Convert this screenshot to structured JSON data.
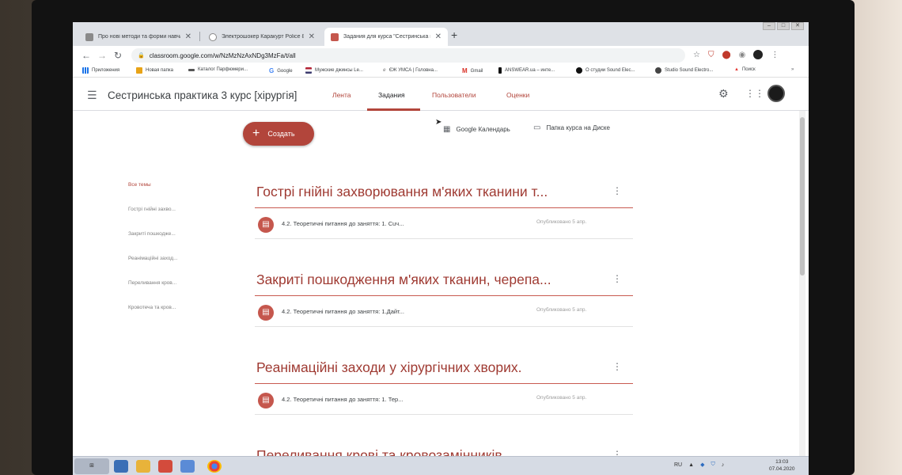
{
  "browser": {
    "tabs": [
      {
        "title": "Про нові методи та форми навчан"
      },
      {
        "title": "Электрошокер Каракурт Police 8L"
      },
      {
        "title": "Задания для курса \"Сестринська п"
      }
    ],
    "new_tab_label": "+",
    "url": "classroom.google.com/w/NzMzNzAxNDg3MzFa/t/all",
    "bookmarks": [
      {
        "label": "Приложения"
      },
      {
        "label": "Новая папка"
      },
      {
        "label": "Каталог Парфюмери..."
      },
      {
        "label": "Google"
      },
      {
        "label": "Мужские джинсы Le..."
      },
      {
        "label": "ЄЖ УМСА | Головна..."
      },
      {
        "label": "Gmail"
      },
      {
        "label": "ANSWEAR.ua – инте..."
      },
      {
        "label": "О студии Sound Elec..."
      },
      {
        "label": "Studio Sound Electro..."
      },
      {
        "label": "Поиск"
      }
    ]
  },
  "header": {
    "course_title": "Сестринська практика 3 курс [хірургія]",
    "tabs": [
      {
        "label": "Лента"
      },
      {
        "label": "Задания"
      },
      {
        "label": "Пользователи"
      },
      {
        "label": "Оценки"
      }
    ]
  },
  "toolbar": {
    "create_label": "Создать",
    "calendar_label": "Google Календарь",
    "drive_label": "Папка курса на Диске"
  },
  "sidebar": {
    "items": [
      {
        "label": "Все темы"
      },
      {
        "label": "Гострі гнійні захво..."
      },
      {
        "label": "Закриті пошкодже..."
      },
      {
        "label": "Реанімаційні заход..."
      },
      {
        "label": "Переливання кров..."
      },
      {
        "label": "Кровотеча та кров..."
      }
    ]
  },
  "topics": [
    {
      "title": "Гострі гнійні захворювання м'яких тканини т...",
      "assignment": "4.2. Теоретичні питання до заняття: 1. Сuч...",
      "published": "Опубликовано 5 апр."
    },
    {
      "title": "Закриті пошкодження м'яких тканин, черепа...",
      "assignment": "4.2. Теоретичні питання до заняття: 1.Дайт...",
      "published": "Опубликовано 5 апр."
    },
    {
      "title": "Реанімаційні заходи у хірургічних хворих.",
      "assignment": "4.2. Теоретичні питання до заняття: 1. Тер...",
      "published": "Опубликовано 5 апр."
    },
    {
      "title": "Переливання крові та кровозамінників."
    }
  ],
  "taskbar": {
    "lang": "RU",
    "time": "13:03",
    "date": "07.04.2020"
  },
  "colors": {
    "accent": "#b2453b",
    "topic_title": "#9f3a32",
    "chrome_tabs": "#dee1e6"
  }
}
